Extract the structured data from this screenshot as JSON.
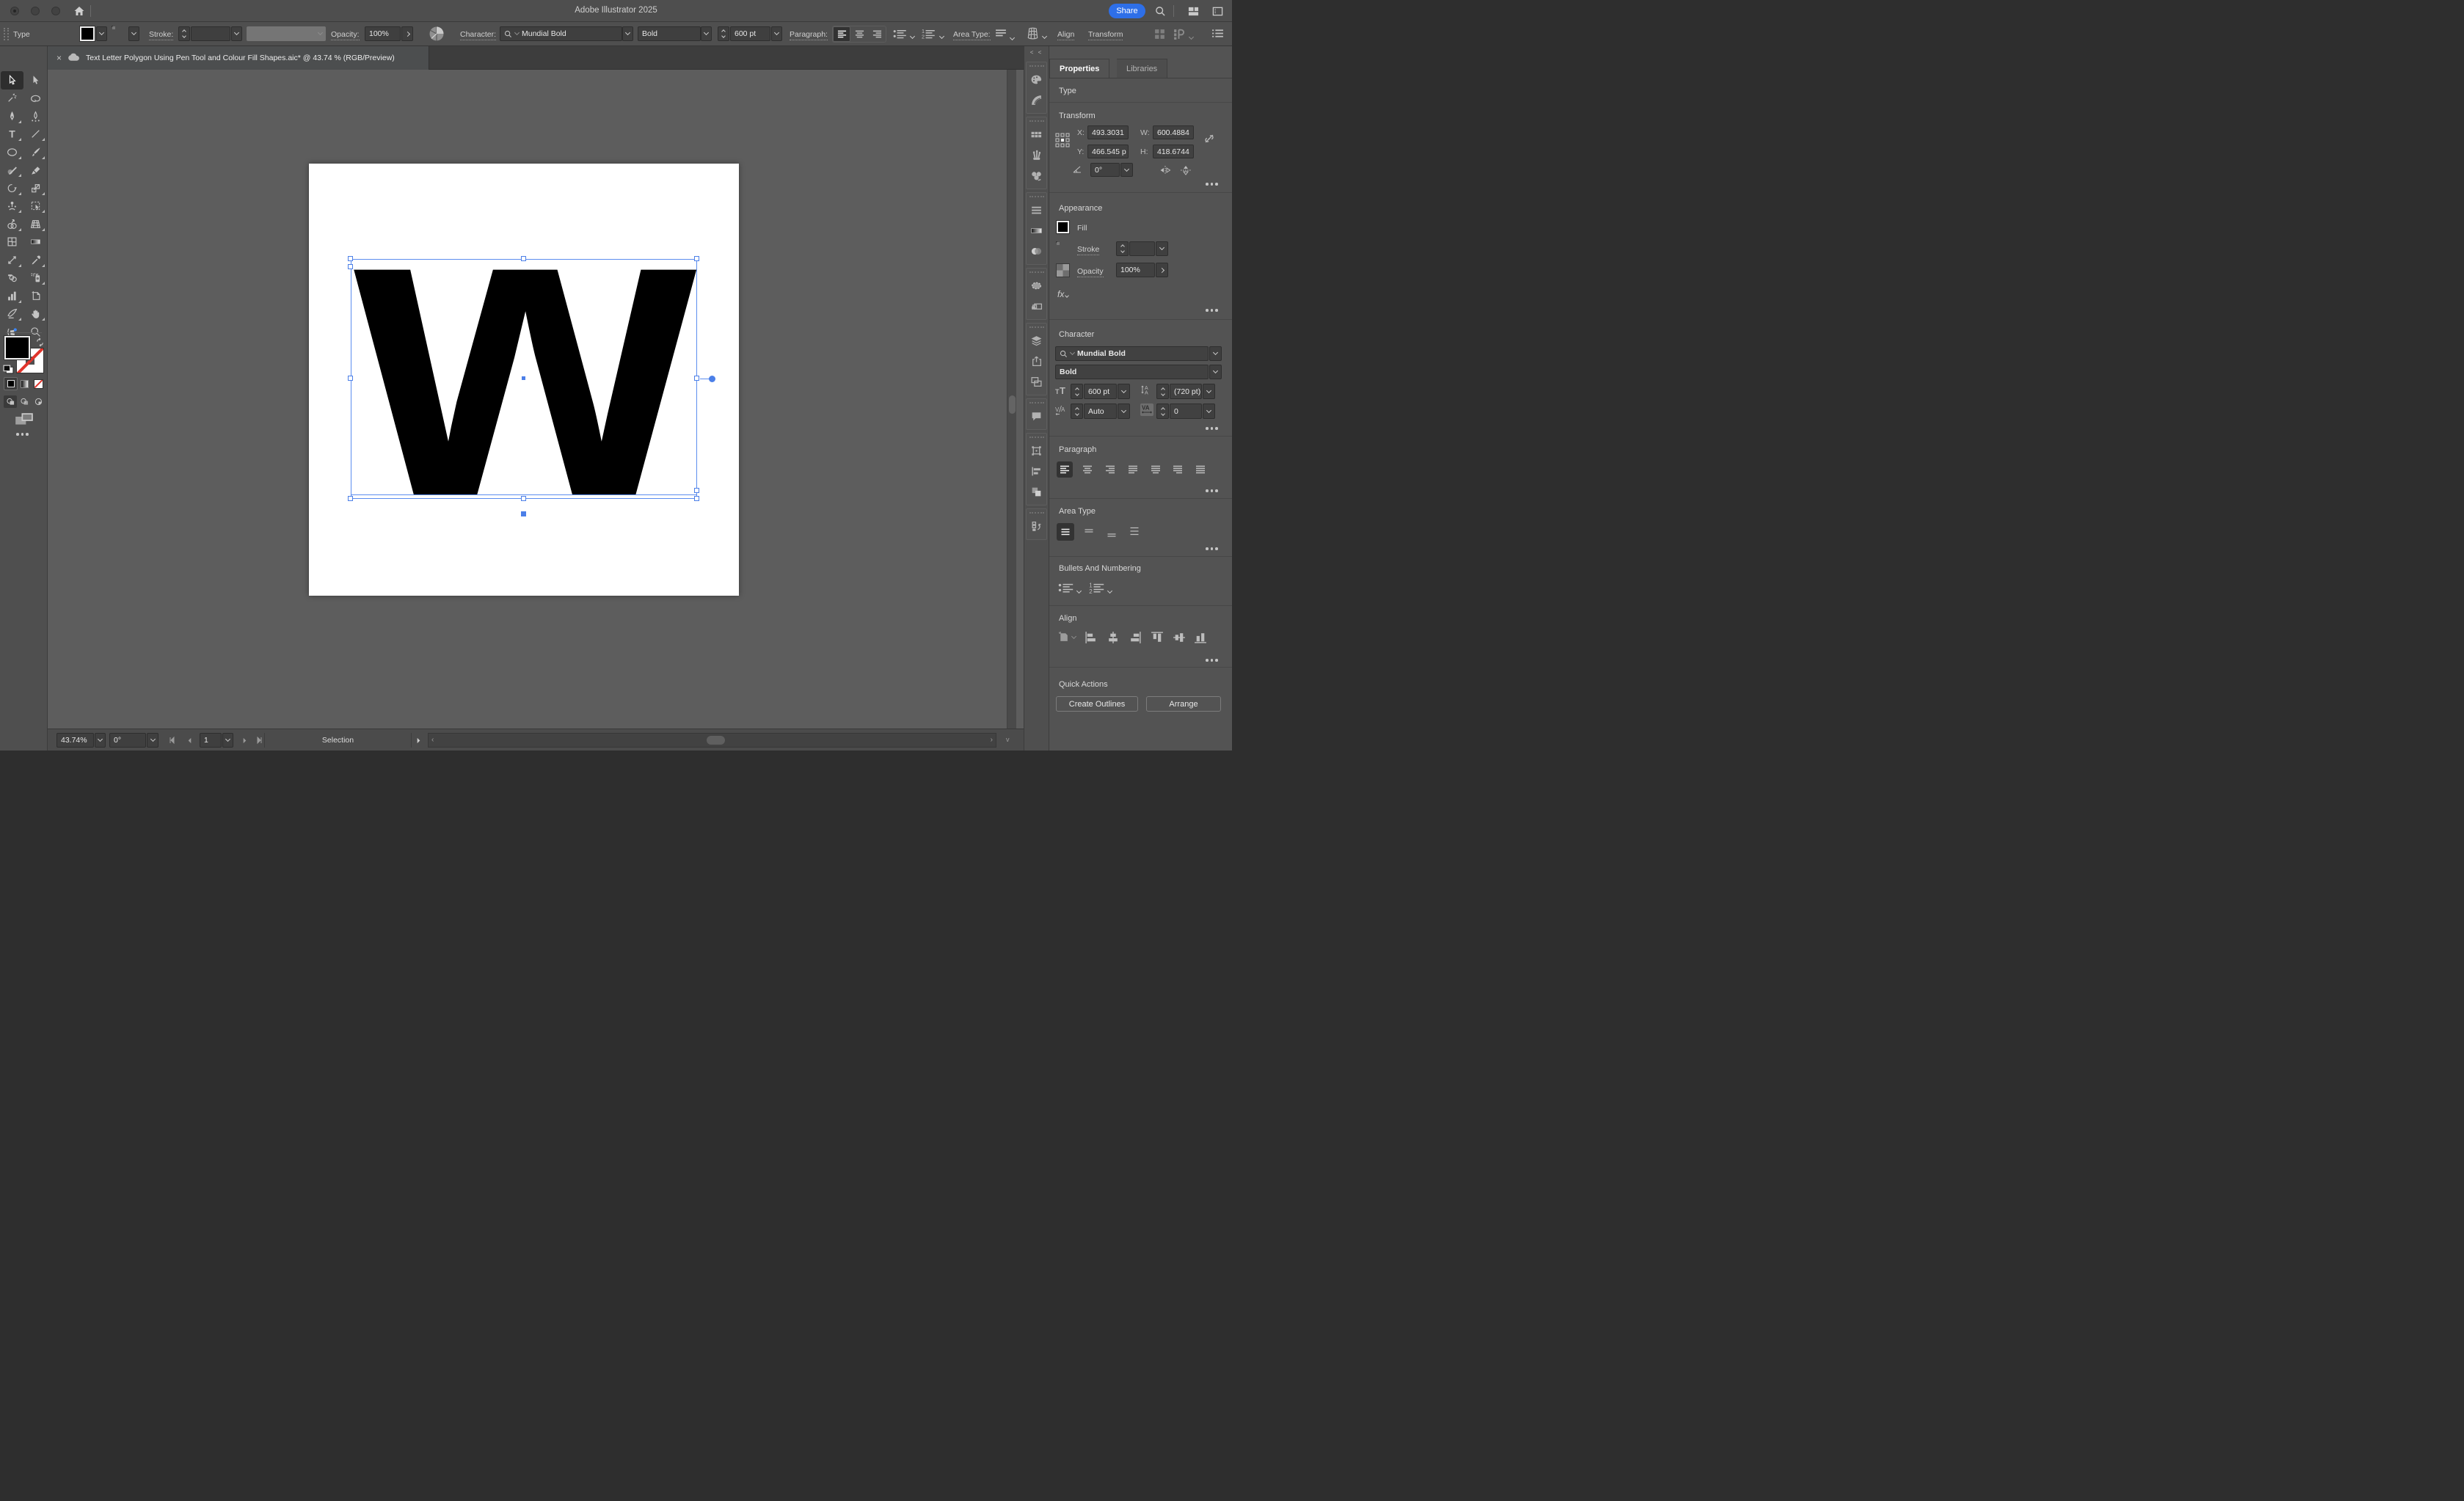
{
  "app": {
    "title": "Adobe Illustrator 2025"
  },
  "titlebar": {
    "share_label": "Share"
  },
  "control_bar": {
    "context_label": "Type",
    "stroke_label": "Stroke:",
    "opacity_label": "Opacity:",
    "opacity_value": "100%",
    "character_label": "Character:",
    "font_name": "Mundial Bold",
    "font_style": "Bold",
    "font_size": "600 pt",
    "paragraph_label": "Paragraph:",
    "area_type_label": "Area Type:",
    "align_label": "Align",
    "transform_label": "Transform"
  },
  "document_tab": {
    "close_glyph": "×",
    "title": "Text Letter Polygon Using Pen Tool and Colour Fill Shapes.aic* @ 43.74 % (RGB/Preview)"
  },
  "toolbar": {
    "tools": [
      "selection",
      "direct-selection",
      "magic-wand",
      "lasso",
      "pen",
      "curvature",
      "type",
      "line-segment",
      "ellipse",
      "paintbrush",
      "shaper",
      "eraser",
      "rotate",
      "scale",
      "puppet-warp",
      "free-transform",
      "shape-builder",
      "perspective-grid",
      "mesh",
      "gradient",
      "width",
      "eyedropper",
      "blend",
      "symbol-sprayer",
      "column-graph",
      "artboard",
      "slice",
      "hand",
      "rotate-view",
      "zoom"
    ],
    "selected_tool": "selection"
  },
  "canvas": {
    "artboard_text": "w"
  },
  "panel": {
    "tabs": [
      {
        "label": "Properties"
      },
      {
        "label": "Libraries"
      }
    ],
    "type_header": "Type",
    "transform": {
      "title": "Transform",
      "x_label": "X:",
      "x_value": "493.3031",
      "y_label": "Y:",
      "y_value": "466.545 p",
      "w_label": "W:",
      "w_value": "600.4884",
      "h_label": "H:",
      "h_value": "418.6744",
      "angle_value": "0°"
    },
    "appearance": {
      "title": "Appearance",
      "fill_label": "Fill",
      "stroke_label": "Stroke",
      "opacity_label": "Opacity",
      "opacity_value": "100%",
      "fx_label": "fx"
    },
    "character": {
      "title": "Character",
      "font_name": "Mundial Bold",
      "font_style": "Bold",
      "size_value": "600 pt",
      "leading_value": "(720 pt)",
      "kerning_value": "Auto",
      "tracking_value": "0"
    },
    "paragraph": {
      "title": "Paragraph"
    },
    "area_type": {
      "title": "Area Type"
    },
    "bullets": {
      "title": "Bullets And Numbering"
    },
    "align": {
      "title": "Align"
    },
    "quick_actions": {
      "title": "Quick Actions",
      "create_outlines_label": "Create Outlines",
      "arrange_label": "Arrange"
    }
  },
  "status_bar": {
    "zoom": "43.74%",
    "rotation": "0°",
    "artboard_number": "1",
    "status_text": "Selection"
  },
  "icons": {
    "collapse_panels": "< <"
  },
  "colors": {
    "accent_blue": "#2e6fe8",
    "selection_blue": "#5b8def",
    "fill_black": "#000000",
    "stroke_none_red": "#e0352c",
    "artboard_white": "#ffffff"
  }
}
